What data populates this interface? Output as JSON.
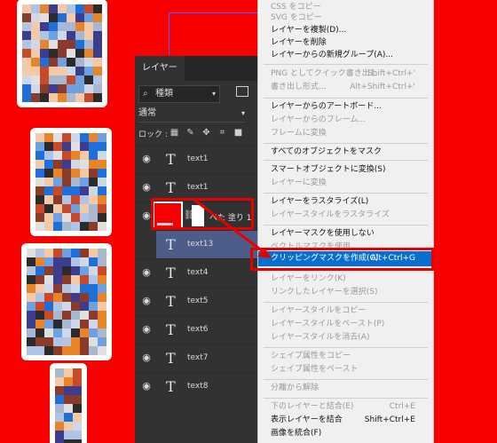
{
  "panel": {
    "tab_label": "レイヤー",
    "kind_label": "種類",
    "blend_mode": "通常",
    "lock_label": "ロック :"
  },
  "layers": [
    {
      "name": "text1",
      "kind": "text",
      "visible": true,
      "selected": false
    },
    {
      "name": "text1",
      "kind": "text",
      "visible": true,
      "selected": false
    },
    {
      "name": "べた 塗り 1",
      "kind": "fill",
      "visible": true,
      "selected": false
    },
    {
      "name": "text13",
      "kind": "text",
      "visible": false,
      "selected": true
    },
    {
      "name": "text4",
      "kind": "text",
      "visible": true,
      "selected": false
    },
    {
      "name": "text5",
      "kind": "text",
      "visible": true,
      "selected": false
    },
    {
      "name": "text6",
      "kind": "text",
      "visible": true,
      "selected": false
    },
    {
      "name": "text7",
      "kind": "text",
      "visible": true,
      "selected": false
    },
    {
      "name": "text8",
      "kind": "text",
      "visible": true,
      "selected": false
    }
  ],
  "menu": {
    "items": [
      {
        "label": "CSS をコピー",
        "shortcut": "",
        "disabled": true
      },
      {
        "label": "SVG をコピー",
        "shortcut": "",
        "disabled": true
      },
      {
        "label": "レイヤーを複製(D)...",
        "shortcut": "",
        "disabled": false
      },
      {
        "label": "レイヤーを削除",
        "shortcut": "",
        "disabled": false
      },
      {
        "label": "レイヤーからの新規グループ(A)...",
        "shortcut": "",
        "disabled": false
      },
      {
        "label": "PNG としてクイック書き出し",
        "shortcut": "Shift+Ctrl+'",
        "disabled": true
      },
      {
        "label": "書き出し形式...",
        "shortcut": "Alt+Shift+Ctrl+'",
        "disabled": true
      },
      {
        "label": "レイヤーからのアートボード...",
        "shortcut": "",
        "disabled": false
      },
      {
        "label": "レイヤーからのフレーム...",
        "shortcut": "",
        "disabled": true
      },
      {
        "label": "フレームに変換",
        "shortcut": "",
        "disabled": true
      },
      {
        "label": "すべてのオブジェクトをマスク",
        "shortcut": "",
        "disabled": false
      },
      {
        "label": "スマートオブジェクトに変換(S)",
        "shortcut": "",
        "disabled": false
      },
      {
        "label": "レイヤーに変換",
        "shortcut": "",
        "disabled": true
      },
      {
        "label": "レイヤーをラスタライズ(L)",
        "shortcut": "",
        "disabled": false
      },
      {
        "label": "レイヤースタイルをラスタライズ",
        "shortcut": "",
        "disabled": true
      },
      {
        "label": "レイヤーマスクを使用しない",
        "shortcut": "",
        "disabled": false
      },
      {
        "label": "ベクトルマスクを使用",
        "shortcut": "",
        "disabled": true
      },
      {
        "label": "クリッピングマスクを作成(C)",
        "shortcut": "Alt+Ctrl+G",
        "disabled": false,
        "highlighted": true
      },
      {
        "label": "レイヤーをリンク(K)",
        "shortcut": "",
        "disabled": true
      },
      {
        "label": "リンクしたレイヤーを選択(S)",
        "shortcut": "",
        "disabled": true
      },
      {
        "label": "レイヤースタイルをコピー",
        "shortcut": "",
        "disabled": true
      },
      {
        "label": "レイヤースタイルをペースト(P)",
        "shortcut": "",
        "disabled": true
      },
      {
        "label": "レイヤースタイルを消去(A)",
        "shortcut": "",
        "disabled": true
      },
      {
        "label": "シェイプ属性をコピー",
        "shortcut": "",
        "disabled": true
      },
      {
        "label": "シェイプ属性をペースト",
        "shortcut": "",
        "disabled": true
      },
      {
        "label": "分離から解除",
        "shortcut": "",
        "disabled": true
      },
      {
        "label": "下のレイヤーと結合(E)",
        "shortcut": "Ctrl+E",
        "disabled": true
      },
      {
        "label": "表示レイヤーを結合",
        "shortcut": "Shift+Ctrl+E",
        "disabled": false
      },
      {
        "label": "画像を統合(F)",
        "shortcut": "",
        "disabled": false
      }
    ]
  },
  "colors": {
    "canvas_background": "#f70000",
    "panel_background": "#323232",
    "selected_layer": "#4c5d8a",
    "menu_highlight": "#0a6ecd",
    "annotation_red": "#e60000"
  },
  "icons": {
    "eye": "eye-icon",
    "text_layer": "text-layer-icon",
    "search": "search-icon",
    "link": "chain-link-icon"
  }
}
